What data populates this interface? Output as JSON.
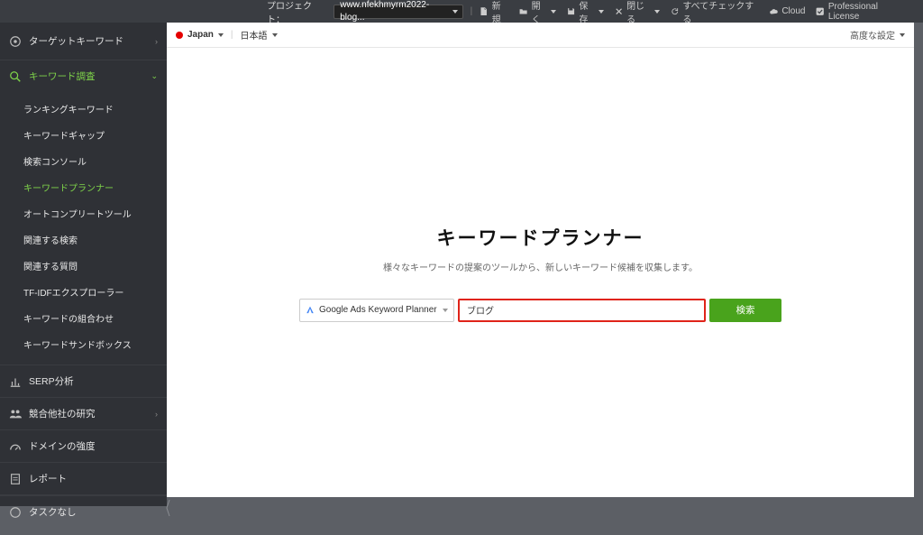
{
  "topbar": {
    "project_label": "プロジェクト：",
    "project_value": "www.nfekhmyrm2022-blog...",
    "items": [
      {
        "icon": "file",
        "label": "新規",
        "caret": false
      },
      {
        "icon": "folder",
        "label": "開く",
        "caret": true
      },
      {
        "icon": "save",
        "label": "保存",
        "caret": true
      },
      {
        "icon": "close",
        "label": "閉じる",
        "caret": true
      },
      {
        "icon": "refresh",
        "label": "すべてチェックする",
        "caret": false
      },
      {
        "icon": "cloud",
        "label": "Cloud",
        "caret": false
      },
      {
        "icon": "check",
        "label": "Professional License",
        "caret": false
      }
    ]
  },
  "sidebar": {
    "target_keyword": "ターゲットキーワード",
    "keyword_research": "キーワード調査",
    "subitems": [
      "ランキングキーワード",
      "キーワードギャップ",
      "検索コンソール",
      "キーワードプランナー",
      "オートコンプリートツール",
      "関連する検索",
      "関連する質問",
      "TF-IDFエクスプローラー",
      "キーワードの組合わせ",
      "キーワードサンドボックス"
    ],
    "active_sub_index": 3,
    "serp": "SERP分析",
    "competitor": "競合他社の研究",
    "domain_strength": "ドメインの強度",
    "report": "レポート",
    "no_task": "タスクなし"
  },
  "main": {
    "country": "Japan",
    "language": "日本語",
    "advanced": "高度な設定",
    "title": "キーワードプランナー",
    "subtitle": "様々なキーワードの提案のツールから、新しいキーワード候補を収集します。",
    "planner_selected": "Google Ads Keyword Planner",
    "keyword_value": "ブログ",
    "search_button": "検索"
  }
}
